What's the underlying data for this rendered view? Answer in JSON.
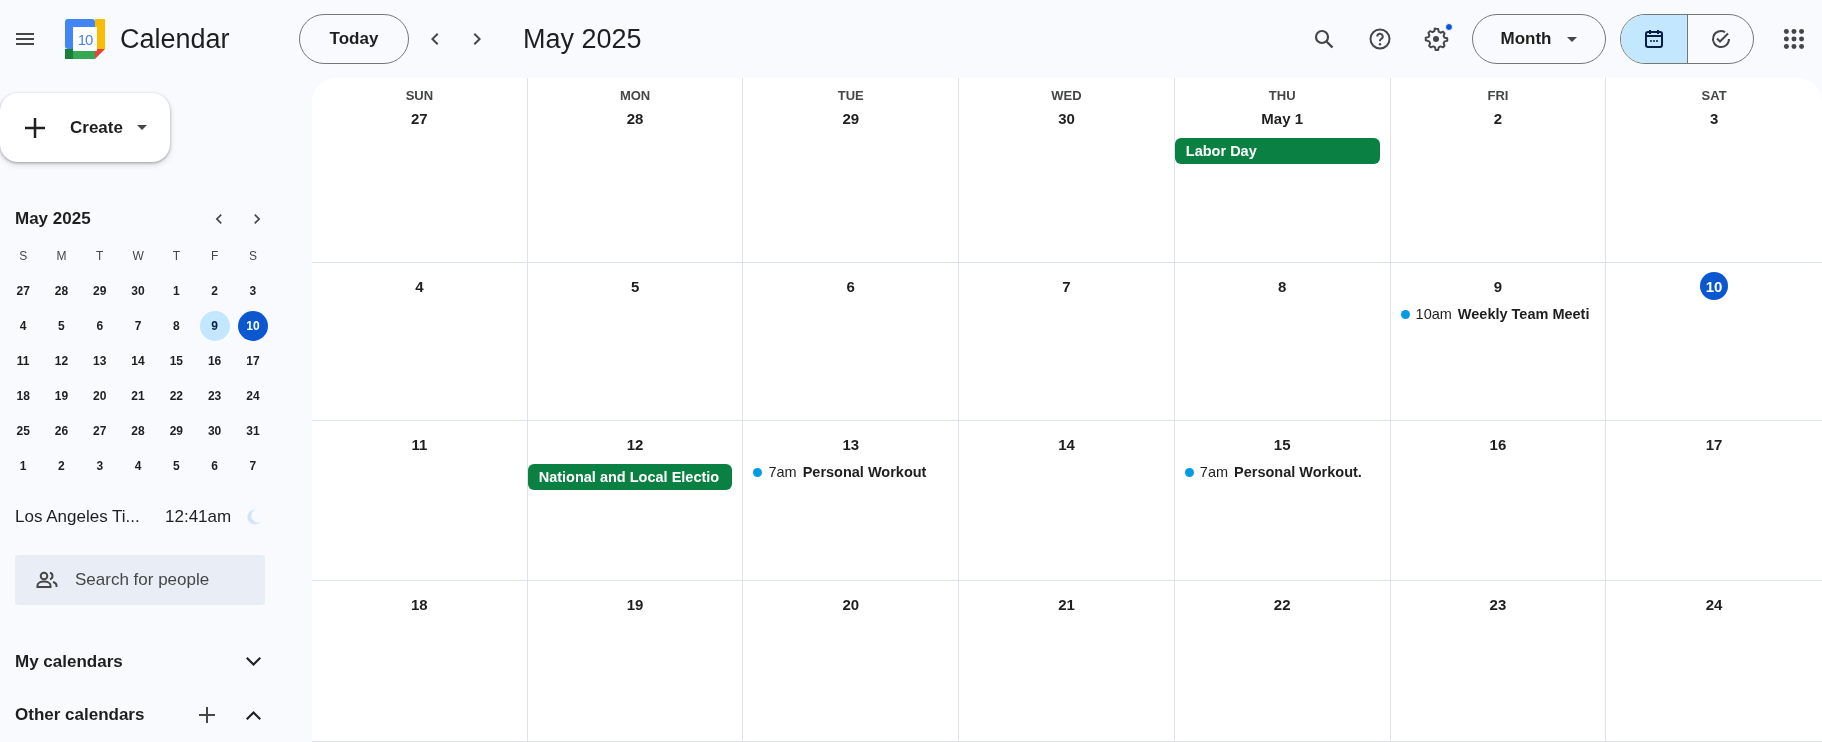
{
  "header": {
    "app_name": "Calendar",
    "logo_day": "10",
    "today_button": "Today",
    "period": "May 2025",
    "view": "Month",
    "settings_badge": true,
    "view_toggle": [
      {
        "kind": "calendar",
        "selected": true
      },
      {
        "kind": "tasks",
        "selected": false
      }
    ]
  },
  "sidebar": {
    "create": "Create",
    "mini_calendar": {
      "title": "May 2025",
      "weekdays": [
        "S",
        "M",
        "T",
        "W",
        "T",
        "F",
        "S"
      ],
      "weeks": [
        [
          {
            "label": "27",
            "selected": false,
            "today": false
          },
          {
            "label": "28",
            "selected": false,
            "today": false
          },
          {
            "label": "29",
            "selected": false,
            "today": false
          },
          {
            "label": "30",
            "selected": false,
            "today": false
          },
          {
            "label": "1",
            "selected": false,
            "today": false
          },
          {
            "label": "2",
            "selected": false,
            "today": false
          },
          {
            "label": "3",
            "selected": false,
            "today": false
          }
        ],
        [
          {
            "label": "4",
            "selected": false,
            "today": false
          },
          {
            "label": "5",
            "selected": false,
            "today": false
          },
          {
            "label": "6",
            "selected": false,
            "today": false
          },
          {
            "label": "7",
            "selected": false,
            "today": false
          },
          {
            "label": "8",
            "selected": false,
            "today": false
          },
          {
            "label": "9",
            "selected": true,
            "today": false
          },
          {
            "label": "10",
            "selected": false,
            "today": true
          }
        ],
        [
          {
            "label": "11",
            "selected": false,
            "today": false
          },
          {
            "label": "12",
            "selected": false,
            "today": false
          },
          {
            "label": "13",
            "selected": false,
            "today": false
          },
          {
            "label": "14",
            "selected": false,
            "today": false
          },
          {
            "label": "15",
            "selected": false,
            "today": false
          },
          {
            "label": "16",
            "selected": false,
            "today": false
          },
          {
            "label": "17",
            "selected": false,
            "today": false
          }
        ],
        [
          {
            "label": "18",
            "selected": false,
            "today": false
          },
          {
            "label": "19",
            "selected": false,
            "today": false
          },
          {
            "label": "20",
            "selected": false,
            "today": false
          },
          {
            "label": "21",
            "selected": false,
            "today": false
          },
          {
            "label": "22",
            "selected": false,
            "today": false
          },
          {
            "label": "23",
            "selected": false,
            "today": false
          },
          {
            "label": "24",
            "selected": false,
            "today": false
          }
        ],
        [
          {
            "label": "25",
            "selected": false,
            "today": false
          },
          {
            "label": "26",
            "selected": false,
            "today": false
          },
          {
            "label": "27",
            "selected": false,
            "today": false
          },
          {
            "label": "28",
            "selected": false,
            "today": false
          },
          {
            "label": "29",
            "selected": false,
            "today": false
          },
          {
            "label": "30",
            "selected": false,
            "today": false
          },
          {
            "label": "31",
            "selected": false,
            "today": false
          }
        ],
        [
          {
            "label": "1",
            "selected": false,
            "today": false
          },
          {
            "label": "2",
            "selected": false,
            "today": false
          },
          {
            "label": "3",
            "selected": false,
            "today": false
          },
          {
            "label": "4",
            "selected": false,
            "today": false
          },
          {
            "label": "5",
            "selected": false,
            "today": false
          },
          {
            "label": "6",
            "selected": false,
            "today": false
          },
          {
            "label": "7",
            "selected": false,
            "today": false
          }
        ]
      ]
    },
    "timezone": {
      "name": "Los Angeles Ti...",
      "time": "12:41am"
    },
    "people_search": {
      "placeholder": "Search for people"
    },
    "sections": [
      {
        "label": "My calendars",
        "expanded": false,
        "add_button": false
      },
      {
        "label": "Other calendars",
        "expanded": true,
        "add_button": true
      }
    ]
  },
  "month": {
    "weekdays": [
      "SUN",
      "MON",
      "TUE",
      "WED",
      "THU",
      "FRI",
      "SAT"
    ],
    "weeks": [
      [
        {
          "label": "27",
          "today": false
        },
        {
          "label": "28",
          "today": false
        },
        {
          "label": "29",
          "today": false
        },
        {
          "label": "30",
          "today": false
        },
        {
          "label": "May 1",
          "today": false,
          "events": [
            {
              "kind": "allday",
              "title": "Labor Day",
              "color": "#0b8043"
            }
          ]
        },
        {
          "label": "2",
          "today": false
        },
        {
          "label": "3",
          "today": false
        }
      ],
      [
        {
          "label": "4",
          "today": false
        },
        {
          "label": "5",
          "today": false
        },
        {
          "label": "6",
          "today": false
        },
        {
          "label": "7",
          "today": false
        },
        {
          "label": "8",
          "today": false
        },
        {
          "label": "9",
          "today": false,
          "events": [
            {
              "kind": "timed",
              "time": "10am",
              "title": "Weekly Team Meeti",
              "color": "#039be5"
            }
          ]
        },
        {
          "label": "10",
          "today": true
        }
      ],
      [
        {
          "label": "11",
          "today": false
        },
        {
          "label": "12",
          "today": false,
          "events": [
            {
              "kind": "allday",
              "title": "National and Local Electio",
              "color": "#0b8043"
            }
          ]
        },
        {
          "label": "13",
          "today": false,
          "events": [
            {
              "kind": "timed",
              "time": "7am",
              "title": "Personal Workout",
              "color": "#039be5"
            }
          ]
        },
        {
          "label": "14",
          "today": false
        },
        {
          "label": "15",
          "today": false,
          "events": [
            {
              "kind": "timed",
              "time": "7am",
              "title": "Personal Workout.",
              "color": "#039be5"
            }
          ]
        },
        {
          "label": "16",
          "today": false
        },
        {
          "label": "17",
          "today": false
        }
      ],
      [
        {
          "label": "18",
          "today": false
        },
        {
          "label": "19",
          "today": false
        },
        {
          "label": "20",
          "today": false
        },
        {
          "label": "21",
          "today": false
        },
        {
          "label": "22",
          "today": false
        },
        {
          "label": "23",
          "today": false
        },
        {
          "label": "24",
          "today": false
        }
      ]
    ]
  }
}
